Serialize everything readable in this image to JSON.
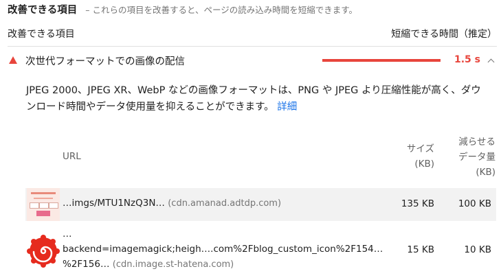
{
  "section": {
    "title": "改善できる項目",
    "description": "– これらの項目を改善すると、ページの読み込み時間を短縮できます。"
  },
  "columns": {
    "left_label": "改善できる項目",
    "right_label": "短縮できる時間（推定）"
  },
  "audit": {
    "title": "次世代フォーマットでの画像の配信",
    "savings": "1.5 s",
    "bar_fraction": 1.0,
    "status_color": "#e8453c",
    "description": "JPEG 2000、JPEG XR、WebP などの画像フォーマットは、PNG や JPEG より圧縮性能が高く、ダウンロード時間やデータ使用量を抑えることができます。",
    "learn_more": "詳細"
  },
  "table": {
    "headers": {
      "url": "URL",
      "size_line1": "サイズ",
      "size_line2": "(KB)",
      "savings_line1": "減らせる",
      "savings_line2": "データ量",
      "savings_line3": "(KB)"
    },
    "rows": [
      {
        "thumbnail_icon": "banner-thumbnail",
        "url": "…imgs/MTU1NzQ3N…",
        "host": "(cdn.amanad.adtdp.com)",
        "size": "135 KB",
        "savings": "100 KB"
      },
      {
        "thumbnail_icon": "spiral-logo-thumbnail",
        "url_prefix": "…",
        "url": "backend=imagemagick;heigh….com%2Fblog_custom_icon%2F154…%2F156…",
        "host": "(cdn.image.st-hatena.com)",
        "size": "15 KB",
        "savings": "10 KB"
      }
    ]
  }
}
